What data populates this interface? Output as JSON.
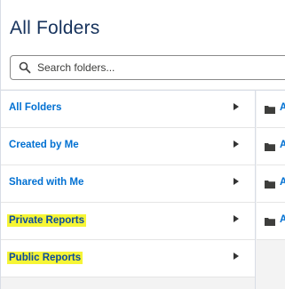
{
  "header": {
    "title": "All Folders",
    "search_placeholder": "Search folders..."
  },
  "nav": {
    "items": [
      {
        "label": "All Folders"
      },
      {
        "label": "Created by Me"
      },
      {
        "label": "Shared with Me"
      },
      {
        "label": "Private Reports"
      },
      {
        "label": "Public Reports"
      }
    ]
  },
  "folders": {
    "rows": [
      {
        "label": "A"
      },
      {
        "label": "A"
      },
      {
        "label": "A"
      },
      {
        "label": "A"
      }
    ]
  },
  "colors": {
    "link": "#0070d2",
    "highlight": "#f6f535",
    "title": "#16325c"
  }
}
